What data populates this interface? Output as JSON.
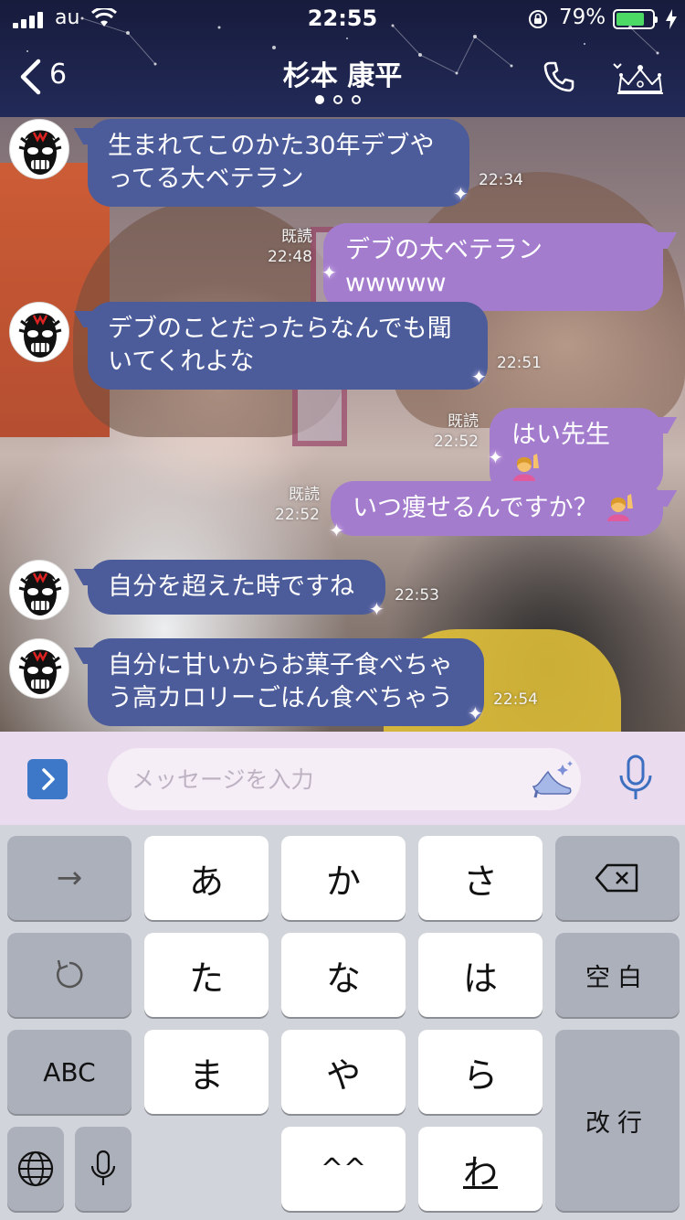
{
  "status_bar": {
    "carrier": "au",
    "time": "22:55",
    "battery_percent": "79%",
    "battery_level": 0.79
  },
  "header": {
    "back_count": "6",
    "title": "杉本 康平",
    "page_indicator": {
      "count": 3,
      "active": 0
    }
  },
  "messages": [
    {
      "side": "in",
      "lines": [
        "生まれてこのかた30年デブや",
        "ってる大ベテラン"
      ],
      "time": "22:34"
    },
    {
      "side": "out",
      "lines": [
        "デブの大ベテランwwwww"
      ],
      "read": "既読",
      "time": "22:48"
    },
    {
      "side": "in",
      "lines": [
        "デブのことだったらなんでも聞",
        "いてくれよな"
      ],
      "time": "22:51"
    },
    {
      "side": "out",
      "lines": [
        "はい先生"
      ],
      "emoji": "raising-hand-emoji",
      "read": "既読",
      "time": "22:52"
    },
    {
      "side": "out",
      "lines": [
        "いつ痩せるんですか？"
      ],
      "emoji": "raising-hand-emoji",
      "read": "既読",
      "time": "22:52"
    },
    {
      "side": "in",
      "lines": [
        "自分を超えた時ですね"
      ],
      "time": "22:53"
    },
    {
      "side": "in",
      "lines": [
        "自分に甘いからお菓子食べちゃ",
        "う高カロリーごはん食べちゃう"
      ],
      "time": "22:54"
    }
  ],
  "input": {
    "placeholder": "メッセージを入力"
  },
  "keyboard": {
    "row1": [
      "→",
      "あ",
      "か",
      "さ",
      "⌫"
    ],
    "row2": [
      "↺",
      "た",
      "な",
      "は",
      "空白"
    ],
    "row3": [
      "ABC",
      "ま",
      "や",
      "ら",
      "改行"
    ],
    "row4": [
      "globe",
      "mic",
      "^^",
      "わ",
      "、。?!"
    ]
  },
  "colors": {
    "header_bg": "#1f2552",
    "incoming_bubble": "#4c5c9a",
    "outgoing_bubble": "#a47cce",
    "input_bar_bg": "#eadcee",
    "battery_green": "#4cd964",
    "accent_blue": "#3d78c8"
  }
}
